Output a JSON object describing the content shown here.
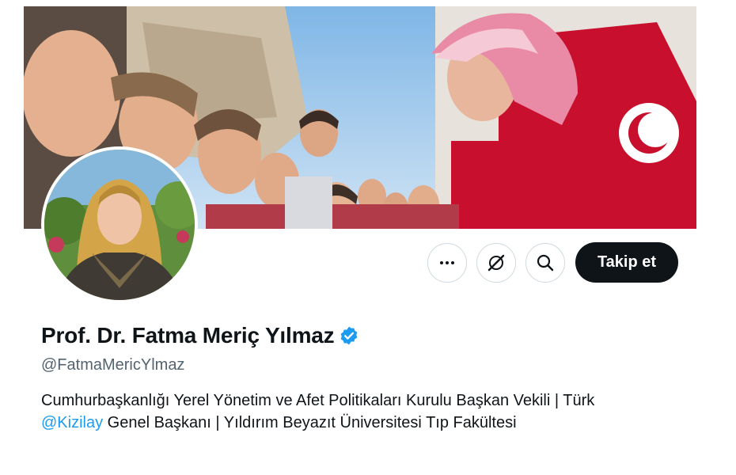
{
  "profile": {
    "display_name": "Prof. Dr. Fatma Meriç Yılmaz",
    "handle": "@FatmaMericYlmaz",
    "verified": true,
    "bio_part1": "Cumhurbaşkanlığı Yerel Yönetim ve Afet Politikaları Kurulu Başkan Vekili | Türk",
    "bio_mention": "@Kizilay",
    "bio_part2": " Genel Başkanı | Yıldırım Beyazıt Üniversitesi Tıp Fakültesi"
  },
  "actions": {
    "more_icon": "more-icon",
    "grok_icon": "grok-icon",
    "search_icon": "search-icon",
    "follow_label": "Takip et"
  },
  "colors": {
    "accent": "#1d9bf0",
    "follow_bg": "#0f1419",
    "secondary_text": "#536471",
    "border": "#cfd9de"
  }
}
